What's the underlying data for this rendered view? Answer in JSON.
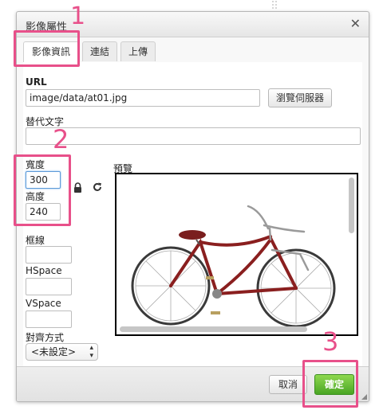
{
  "dialog": {
    "title": "影像屬性",
    "close_icon": "close-icon"
  },
  "tabs": [
    {
      "label": "影像資訊",
      "active": true
    },
    {
      "label": "連結",
      "active": false
    },
    {
      "label": "上傳",
      "active": false
    }
  ],
  "form": {
    "url_label": "URL",
    "url_value": "image/data/at01.jpg",
    "browse_label": "瀏覽伺服器",
    "alt_label": "替代文字",
    "alt_value": "",
    "width_label": "寬度",
    "width_value": "300",
    "height_label": "高度",
    "height_value": "240",
    "lock_icon": "lock-icon",
    "reset_icon": "reset-size-icon",
    "border_label": "框線",
    "border_value": "",
    "hspace_label": "HSpace",
    "hspace_value": "",
    "vspace_label": "VSpace",
    "vspace_value": "",
    "align_label": "對齊方式",
    "align_value": "<未設定>"
  },
  "preview": {
    "label": "預覽",
    "image": "bicycle"
  },
  "footer": {
    "cancel_label": "取消",
    "ok_label": "確定"
  },
  "annotations": {
    "n1": "1",
    "n2": "2",
    "n3": "3",
    "color": "#e8508a"
  },
  "colors": {
    "ok_button": "#5bb52e",
    "bike_frame": "#8a1f1f"
  }
}
